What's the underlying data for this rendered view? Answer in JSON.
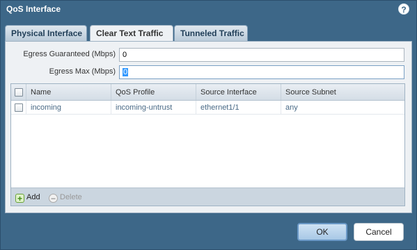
{
  "dialog": {
    "title": "QoS Interface",
    "help_icon": "help-icon",
    "help_glyph": "?"
  },
  "tabs": [
    {
      "label": "Physical Interface",
      "active": false
    },
    {
      "label": "Clear Text Traffic",
      "active": true
    },
    {
      "label": "Tunneled Traffic",
      "active": false
    }
  ],
  "form": {
    "egress_guaranteed_label": "Egress Guaranteed (Mbps)",
    "egress_guaranteed_value": "0",
    "egress_max_label": "Egress Max (Mbps)",
    "egress_max_value": "0"
  },
  "table": {
    "columns": [
      "Name",
      "QoS Profile",
      "Source Interface",
      "Source Subnet"
    ],
    "rows": [
      {
        "name": "incoming",
        "qos_profile": "incoming-untrust",
        "source_interface": "ethernet1/1",
        "source_subnet": "any"
      }
    ]
  },
  "footer": {
    "add_label": "Add",
    "delete_label": "Delete",
    "add_glyph": "+",
    "delete_glyph": "−"
  },
  "buttons": {
    "ok_label": "OK",
    "cancel_label": "Cancel"
  },
  "colors": {
    "dialog_bg": "#3d6788",
    "row_text": "#4a6a86",
    "add_icon": "#3d8a12"
  }
}
